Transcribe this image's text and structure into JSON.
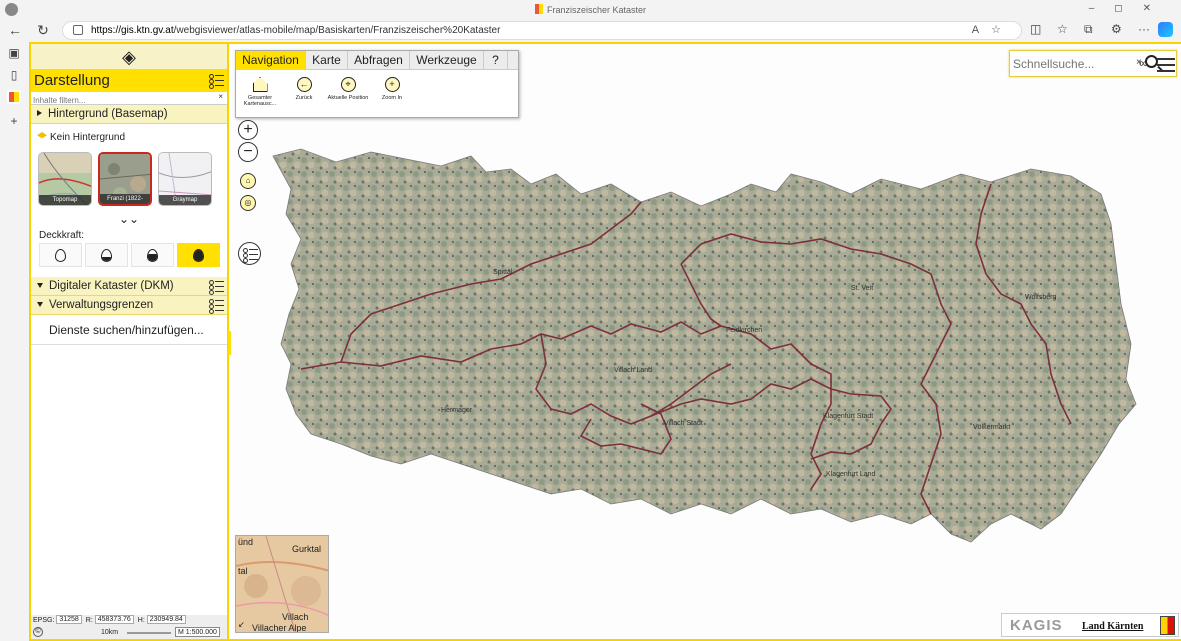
{
  "browser": {
    "tab_title": "Franziszeischer Kataster",
    "url_host": "https://gis.ktn.gv.at",
    "url_path": "/webgisviewer/atlas-mobile/map/Basiskarten/Franziszeischer%20Kataster"
  },
  "panel": {
    "title": "Darstellung",
    "filter_placeholder": "Inhalte filtern...",
    "filter_clear": "×",
    "basemap_group": "Hintergrund (Basemap)",
    "no_background": "Kein Hintergrund",
    "thumbnails": [
      "Topomap",
      "Franzi (1822-1828)",
      "Graymap"
    ],
    "selected_thumbnail": 1,
    "opacity_label": "Deckkraft:",
    "opacity_levels": [
      0,
      0.33,
      0.66,
      1
    ],
    "selected_opacity": 3,
    "groups": [
      "Digitaler Kataster (DKM)",
      "Verwaltungsgrenzen"
    ],
    "add_services": "Dienste suchen/hinzufügen...",
    "coords": {
      "epsg_label": "EPSG:",
      "epsg_value": "31258",
      "r_label": "R:",
      "r_value": "458373.76",
      "h_label": "H:",
      "h_value": "230949.84"
    },
    "scale": {
      "copyright": "©",
      "distance": "10km",
      "ratio": "M 1:500.000"
    },
    "collapse_icon": "«"
  },
  "toolbar": {
    "tabs": [
      "Navigation",
      "Karte",
      "Abfragen",
      "Werkzeuge",
      "?"
    ],
    "active_tab": 0,
    "buttons": [
      {
        "label": "Gesamter Kartenausc...",
        "icon": "home-icon"
      },
      {
        "label": "Zurück",
        "icon": "back-icon"
      },
      {
        "label": "Aktuelle Position",
        "icon": "locate-icon"
      },
      {
        "label": "Zoom In",
        "icon": "zoom-in-icon"
      }
    ]
  },
  "search": {
    "placeholder": "Schnellsuche...",
    "clear": "×"
  },
  "map": {
    "places": [
      "Spittal",
      "St. Veit",
      "Wolfsberg",
      "Feldkirchen",
      "Villach Land",
      "Hermagor",
      "Villach Stadt",
      "Klagenfurt Stadt",
      "Völkermarkt",
      "Klagenfurt Land"
    ]
  },
  "overview": {
    "labels": [
      "ünd",
      "Gurktal",
      "tal",
      "Villach",
      "Villacher Alpe"
    ]
  },
  "logo": {
    "kagis": "KAGIS",
    "land": "Land Kärnten"
  }
}
